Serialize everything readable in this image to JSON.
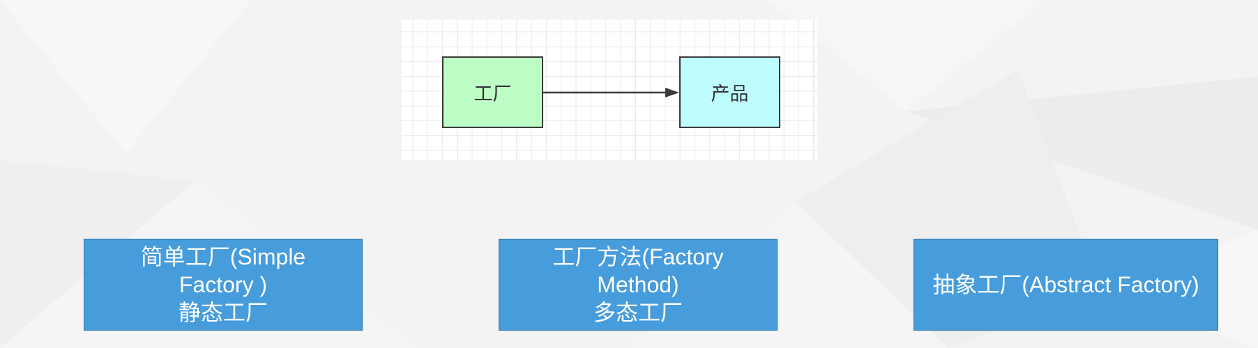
{
  "diagram": {
    "factory_label": "工厂",
    "product_label": "产品",
    "factory_color": "#bdfdc6",
    "product_color": "#befdfe",
    "arrow": "factory-to-product"
  },
  "patterns": [
    {
      "line1": "简单工厂(Simple",
      "line2": "Factory )",
      "line3": "静态工厂"
    },
    {
      "line1": "工厂方法(Factory",
      "line2": "Method)",
      "line3": "多态工厂"
    },
    {
      "line1": "抽象工厂(Abstract Factory)"
    }
  ],
  "colors": {
    "box_fill": "#479cdb",
    "box_text": "#ffffff"
  }
}
